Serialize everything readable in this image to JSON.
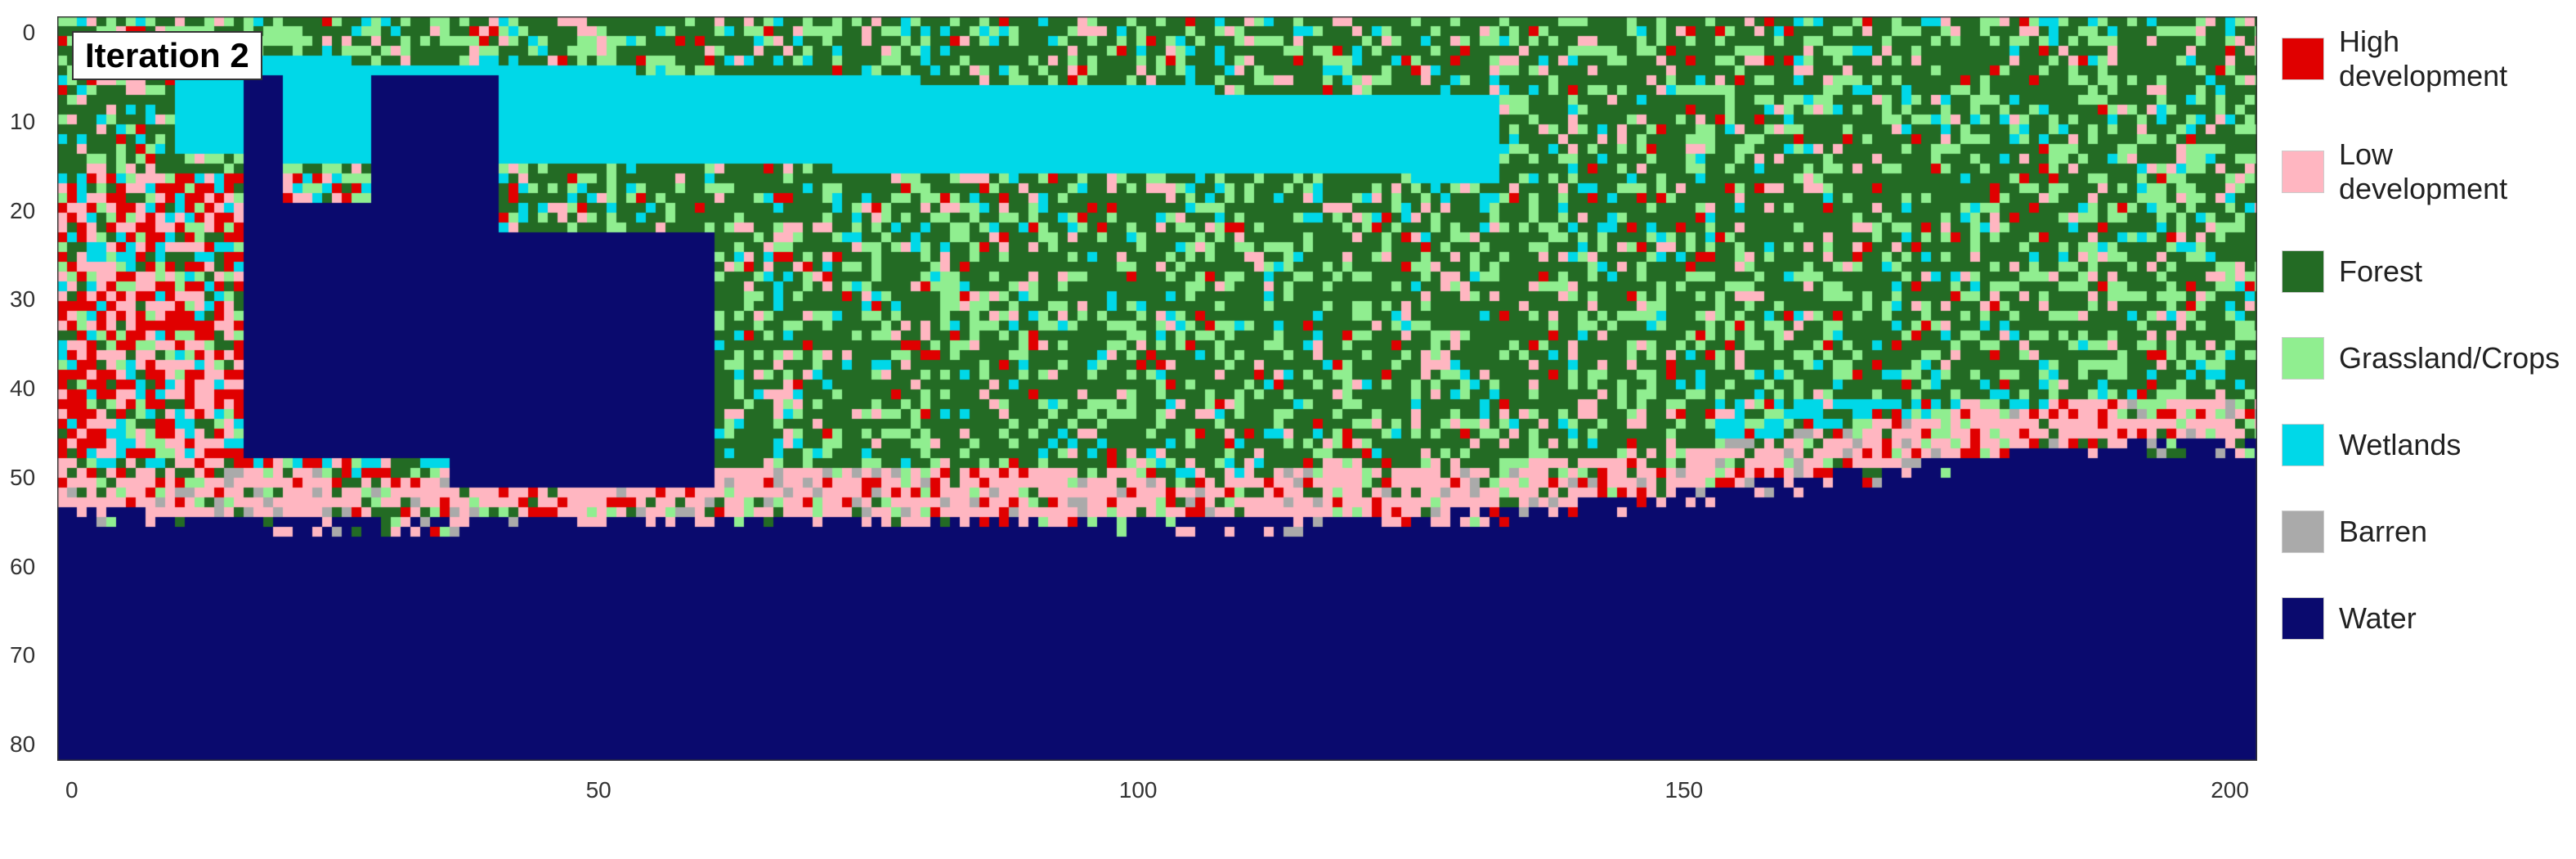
{
  "title": "Iteration 2",
  "legend": {
    "items": [
      {
        "label": "High development",
        "color": "#e00000",
        "id": "high-development"
      },
      {
        "label": "Low development",
        "color": "#ffb6c1",
        "id": "low-development"
      },
      {
        "label": "Forest",
        "color": "#236b24",
        "id": "forest"
      },
      {
        "label": "Grassland/Crops",
        "color": "#90ee90",
        "id": "grassland-crops"
      },
      {
        "label": "Wetlands",
        "color": "#00d8e8",
        "id": "wetlands"
      },
      {
        "label": "Barren",
        "color": "#aaaaaa",
        "id": "barren"
      },
      {
        "label": "Water",
        "color": "#0a0a6e",
        "id": "water"
      }
    ]
  },
  "x_axis": {
    "ticks": [
      "0",
      "50",
      "100",
      "150",
      "200"
    ]
  },
  "y_axis": {
    "ticks": [
      "0",
      "10",
      "20",
      "30",
      "40",
      "50",
      "60",
      "70",
      "80"
    ]
  }
}
